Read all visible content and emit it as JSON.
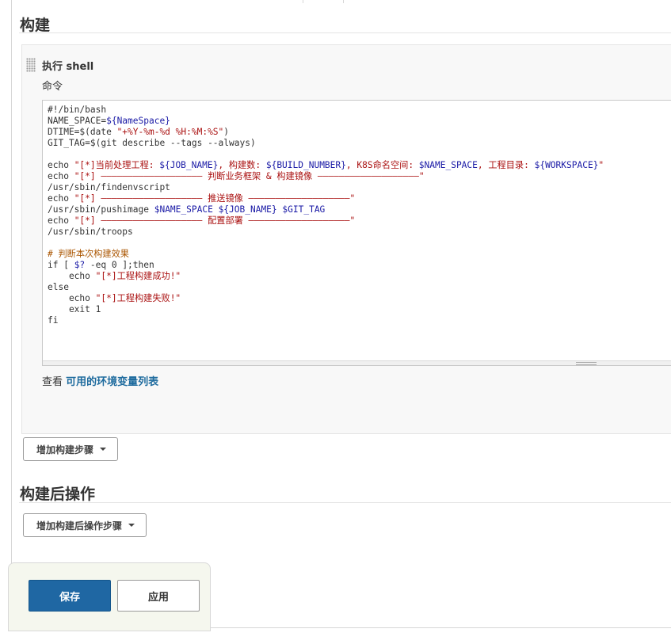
{
  "build_section": {
    "title": "构建",
    "step": {
      "title": "执行 shell",
      "command_label": "命令",
      "code_lines": [
        "#!/bin/bash",
        "NAME_SPACE=${NameSpace}",
        "DTIME=$(date \"+%Y-%m-%d %H:%M:%S\")",
        "GIT_TAG=$(git describe --tags --always)",
        "",
        "echo \"[*]当前处理工程: ${JOB_NAME}, 构建数: ${BUILD_NUMBER}, K8S命名空间: $NAME_SPACE, 工程目录: ${WORKSPACE}\"",
        "echo \"[*] ——————————————————— 判断业务框架 & 构建镜像 ———————————————————\"",
        "/usr/sbin/findenvscript",
        "echo \"[*] ——————————————————— 推送镜像 ———————————————————\"",
        "/usr/sbin/pushimage $NAME_SPACE ${JOB_NAME} $GIT_TAG",
        "echo \"[*] ——————————————————— 配置部署 ———————————————————\"",
        "/usr/sbin/troops",
        "",
        "# 判断本次构建效果",
        "if [ $? -eq 0 ];then",
        "    echo \"[*]工程构建成功!\"",
        "else",
        "    echo \"[*]工程构建失败!\"",
        "    exit 1",
        "fi"
      ],
      "env_prefix": "查看",
      "env_link": "可用的环境变量列表"
    },
    "add_step_button": "增加构建步骤"
  },
  "post_build_section": {
    "title": "构建后操作",
    "add_step_button": "增加构建后操作步骤"
  },
  "actions": {
    "save": "保存",
    "apply": "应用"
  }
}
